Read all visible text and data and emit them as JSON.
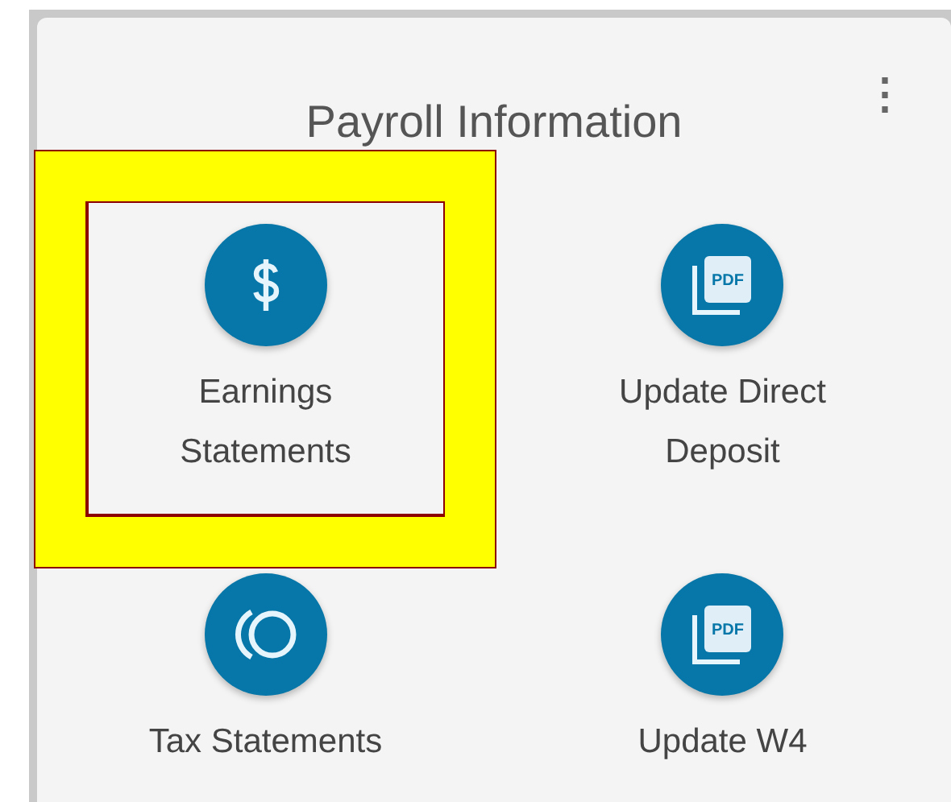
{
  "card": {
    "title": "Payroll Information",
    "menu": "⋮",
    "items": [
      {
        "kind": "dollar",
        "label": "Earnings Statements",
        "highlighted": true
      },
      {
        "kind": "pdf",
        "badge": "PDF",
        "label": "Update Direct Deposit",
        "highlighted": false
      },
      {
        "kind": "rings",
        "label": "Tax Statements",
        "highlighted": false
      },
      {
        "kind": "pdf",
        "badge": "PDF",
        "label": "Update W4",
        "highlighted": false
      }
    ]
  }
}
